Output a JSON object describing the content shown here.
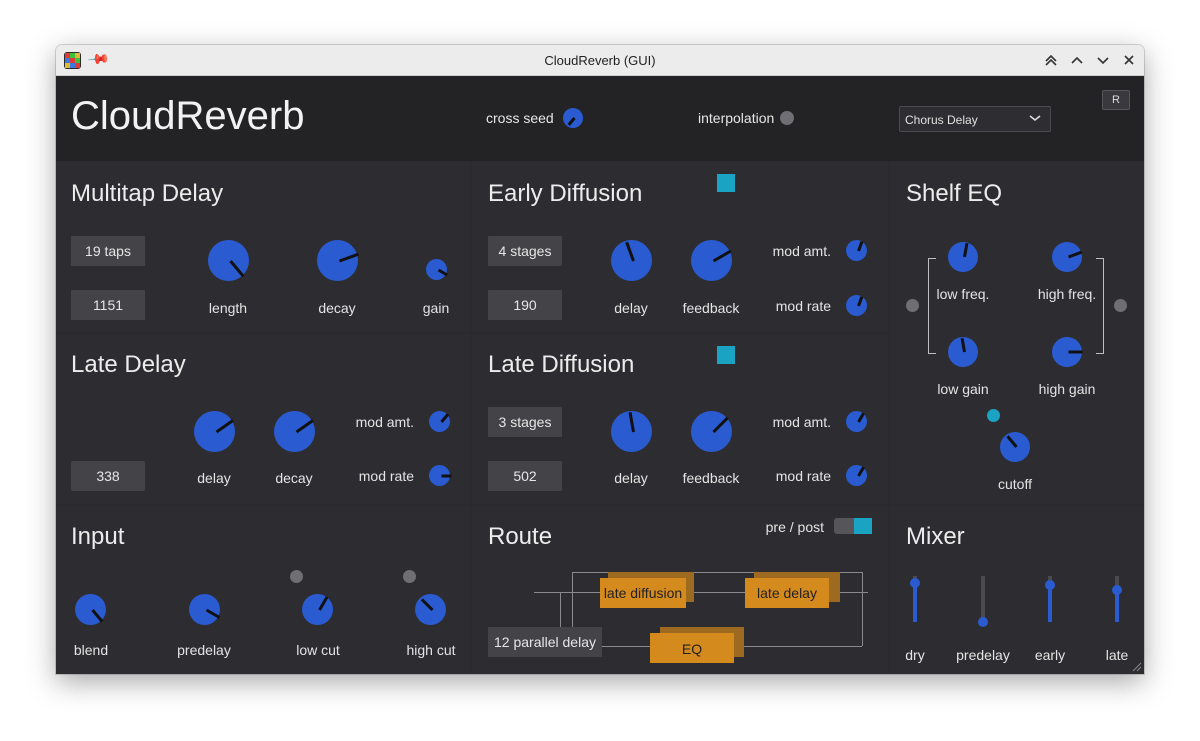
{
  "window": {
    "title": "CloudReverb (GUI)"
  },
  "header": {
    "app_name": "CloudReverb",
    "cross_seed_label": "cross seed",
    "interpolation_label": "interpolation",
    "preset": "Chorus Delay",
    "reset_label": "R"
  },
  "multitap": {
    "title": "Multitap Delay",
    "taps": "19 taps",
    "value": "1151",
    "length": "length",
    "decay": "decay",
    "gain": "gain"
  },
  "early": {
    "title": "Early Diffusion",
    "stages": "4 stages",
    "value": "190",
    "delay": "delay",
    "feedback": "feedback",
    "mod_amt": "mod amt.",
    "mod_rate": "mod rate"
  },
  "shelf": {
    "title": "Shelf EQ",
    "low_freq": "low freq.",
    "high_freq": "high freq.",
    "low_gain": "low gain",
    "high_gain": "high gain",
    "cutoff": "cutoff"
  },
  "late_delay": {
    "title": "Late Delay",
    "value": "338",
    "delay": "delay",
    "decay": "decay",
    "mod_amt": "mod amt.",
    "mod_rate": "mod rate"
  },
  "late_diff": {
    "title": "Late Diffusion",
    "stages": "3 stages",
    "value": "502",
    "delay": "delay",
    "feedback": "feedback",
    "mod_amt": "mod amt.",
    "mod_rate": "mod rate"
  },
  "input": {
    "title": "Input",
    "blend": "blend",
    "predelay": "predelay",
    "low_cut": "low cut",
    "high_cut": "high cut"
  },
  "route": {
    "title": "Route",
    "pre_post": "pre / post",
    "late_diffusion": "late diffusion",
    "late_delay": "late delay",
    "eq": "EQ",
    "parallel": "12 parallel delay"
  },
  "mixer": {
    "title": "Mixer",
    "dry": "dry",
    "predelay": "predelay",
    "early": "early",
    "late": "late",
    "levels": {
      "dry": 0.85,
      "predelay": 0.0,
      "early": 0.8,
      "late": 0.7
    }
  },
  "colors": {
    "knob": "#2a5bd1",
    "accent": "#1aa3c2",
    "route_box": "#d58a1e",
    "background": "#2b2b2e"
  }
}
